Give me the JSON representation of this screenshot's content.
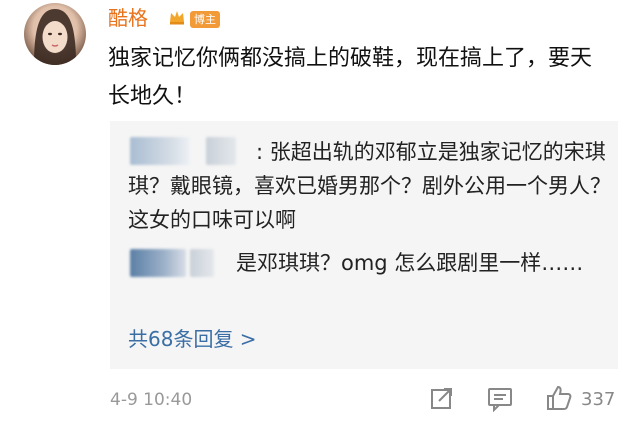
{
  "post": {
    "username": "酷格",
    "badge": "博主",
    "text": "独家记忆你俩都没搞上的破鞋，现在搞上了，要天长地久！",
    "time": "4-9 10:40"
  },
  "quote": {
    "comment1_text": ": 张超出轨的邓郁立是独家记忆的宋琪琪？戴眼镜，喜欢已婚男那个？剧外公用一个男人？这女的口味可以啊",
    "comment2_text": "是邓琪琪？omg 怎么跟剧里一样……",
    "reply_count_label": "共68条回复 >"
  },
  "actions": {
    "like_count": "337",
    "icons": [
      "share-icon",
      "comment-icon",
      "like-icon"
    ]
  },
  "colors": {
    "username": "#e8731c",
    "badge_bg": "#f29a38",
    "link": "#3a6ea5",
    "quote_bg": "#f5f5f5",
    "meta": "#999999"
  }
}
